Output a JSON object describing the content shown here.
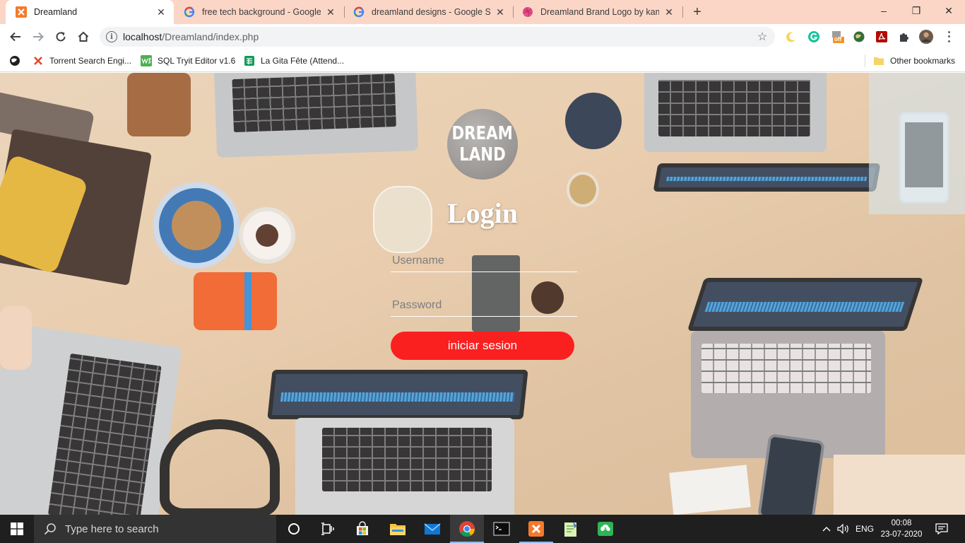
{
  "browser": {
    "tabs": [
      {
        "title": "Dreamland",
        "icon": "xampp-icon",
        "active": true
      },
      {
        "title": "free tech background - Google S",
        "icon": "google-icon",
        "active": false
      },
      {
        "title": "dreamland designs - Google Sea",
        "icon": "google-icon",
        "active": false
      },
      {
        "title": "Dreamland Brand Logo by kamru",
        "icon": "dribbble-icon",
        "active": false
      }
    ],
    "new_tab": "+",
    "window_controls": {
      "minimize": "–",
      "maximize": "❐",
      "close": "✕"
    },
    "address": {
      "host": "localhost",
      "path": "/Dreamland/index.php"
    },
    "bookmarks": [
      {
        "label": "Torrent Search Engi...",
        "icon": "x-icon"
      },
      {
        "label": "SQL Tryit Editor v1.6",
        "icon": "w3schools-icon"
      },
      {
        "label": "La Gita Fête (Attend...",
        "icon": "sheets-icon"
      }
    ],
    "other_bookmarks": "Other bookmarks",
    "extension_badge": "off"
  },
  "page": {
    "logo_line1": "DREAM",
    "logo_line2": "LAND",
    "login_title": "Login",
    "username_placeholder": "Username",
    "password_placeholder": "Password",
    "submit_label": "iniciar sesion",
    "accent_color": "#fb2020"
  },
  "taskbar": {
    "search_placeholder": "Type here to search",
    "language": "ENG",
    "time": "00:08",
    "date": "23-07-2020"
  }
}
